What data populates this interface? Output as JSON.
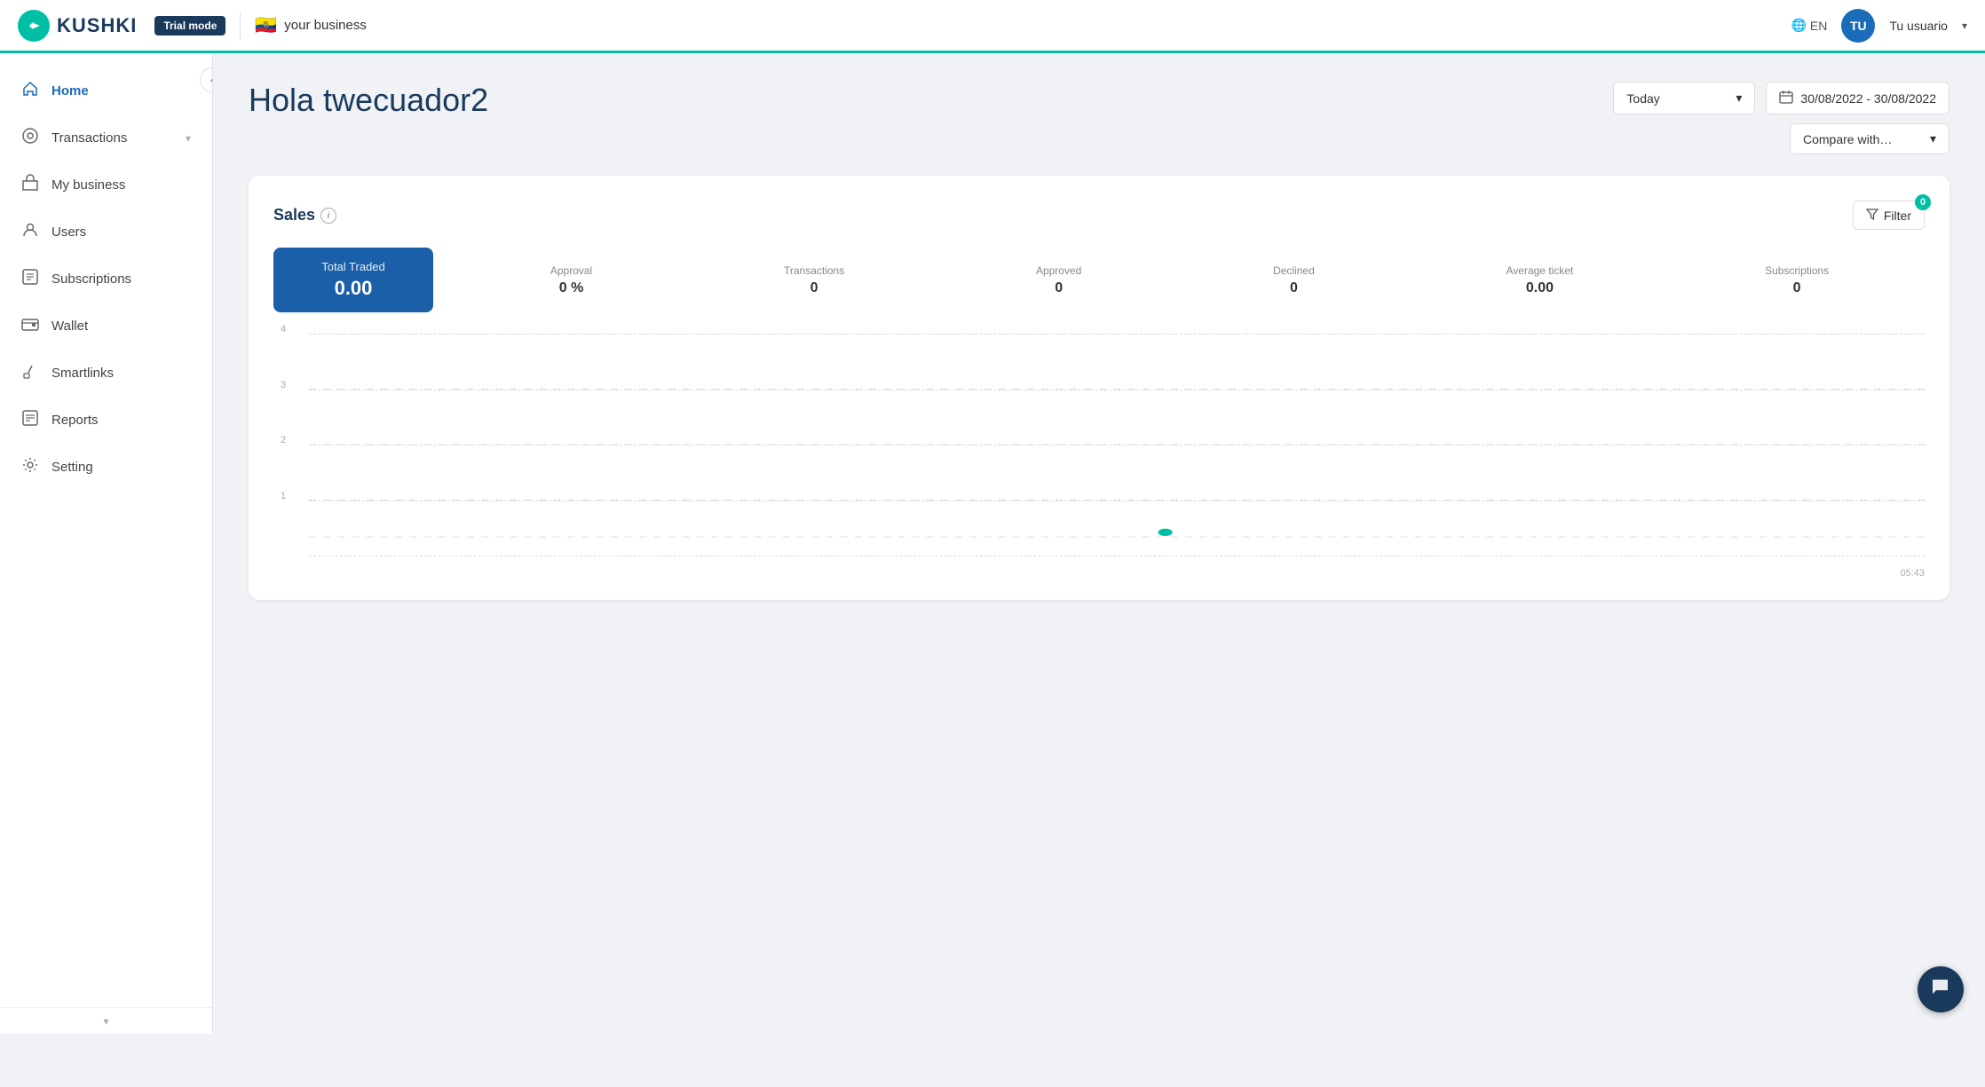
{
  "topnav": {
    "logo_text": "KUSHKI",
    "logo_initials": "K",
    "trial_badge": "Trial mode",
    "business_name": "your business",
    "flag": "🇪🇨",
    "lang": "EN",
    "user_initials": "TU",
    "user_name": "Tu usuario"
  },
  "sidebar": {
    "collapse_icon": "‹",
    "items": [
      {
        "id": "home",
        "label": "Home",
        "icon": "⌂",
        "active": true
      },
      {
        "id": "transactions",
        "label": "Transactions",
        "icon": "◎",
        "has_chevron": true
      },
      {
        "id": "my-business",
        "label": "My business",
        "icon": "▦"
      },
      {
        "id": "users",
        "label": "Users",
        "icon": "👤"
      },
      {
        "id": "subscriptions",
        "label": "Subscriptions",
        "icon": "▤"
      },
      {
        "id": "wallet",
        "label": "Wallet",
        "icon": "▬"
      },
      {
        "id": "smartlinks",
        "label": "Smartlinks",
        "icon": "✎"
      },
      {
        "id": "reports",
        "label": "Reports",
        "icon": "≡"
      },
      {
        "id": "setting",
        "label": "Setting",
        "icon": "⚙"
      }
    ]
  },
  "page": {
    "greeting": "Hola twecuador2"
  },
  "controls": {
    "period_label": "Today",
    "date_range": "30/08/2022 - 30/08/2022",
    "compare_label": "Compare with…"
  },
  "sales": {
    "title": "Sales",
    "filter_label": "Filter",
    "filter_badge": "0",
    "stats": {
      "total_traded_label": "Total Traded",
      "total_traded_value": "0.00",
      "approval_label": "Approval",
      "approval_value": "0 %",
      "transactions_label": "Transactions",
      "transactions_value": "0",
      "approved_label": "Approved",
      "approved_value": "0",
      "declined_label": "Declined",
      "declined_value": "0",
      "avg_ticket_label": "Average ticket",
      "avg_ticket_value": "0.00",
      "subscriptions_label": "Subscriptions",
      "subscriptions_value": "0"
    },
    "chart": {
      "y_labels": [
        "4",
        "3",
        "2",
        "1"
      ],
      "x_label": "05:43",
      "dot_x_percent": 53,
      "dot_y_percent": 92
    }
  },
  "chat": {
    "icon": "💬"
  }
}
